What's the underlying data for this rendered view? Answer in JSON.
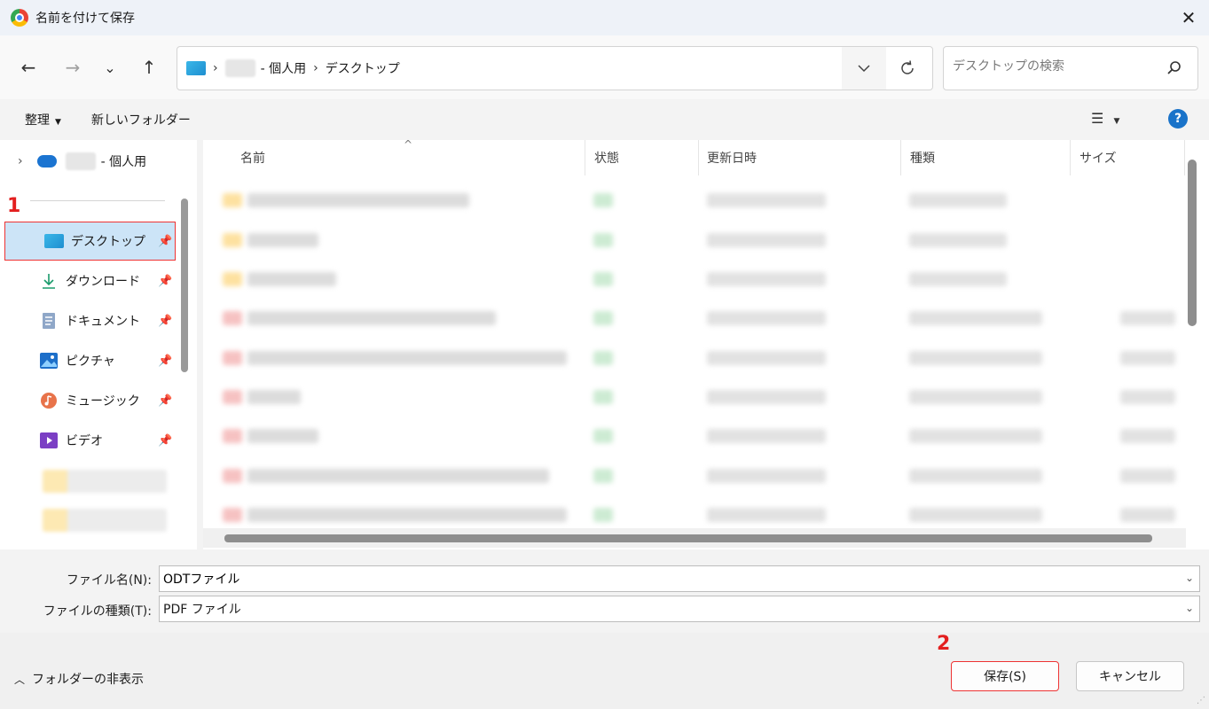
{
  "window": {
    "title": "名前を付けて保存",
    "close_label": "✕"
  },
  "nav": {
    "back": "←",
    "forward": "→",
    "recent": "⌄",
    "up": "↑",
    "breadcrumb": {
      "account_suffix": "- 個人用",
      "current": "デスクトップ",
      "separator": "›"
    },
    "search_placeholder": "デスクトップの検索"
  },
  "commands": {
    "organize": "整理",
    "new_folder": "新しいフォルダー"
  },
  "sidebar": {
    "onedrive_suffix": "- 個人用",
    "items": [
      {
        "label": "デスクトップ",
        "icon": "desktop-icon",
        "pinned": true,
        "selected": true
      },
      {
        "label": "ダウンロード",
        "icon": "download-icon",
        "pinned": true
      },
      {
        "label": "ドキュメント",
        "icon": "document-icon",
        "pinned": true
      },
      {
        "label": "ピクチャ",
        "icon": "pictures-icon",
        "pinned": true
      },
      {
        "label": "ミュージック",
        "icon": "music-icon",
        "pinned": true
      },
      {
        "label": "ビデオ",
        "icon": "video-icon",
        "pinned": true
      }
    ]
  },
  "columns": [
    "名前",
    "状態",
    "更新日時",
    "種類",
    "サイズ"
  ],
  "filename": {
    "label": "ファイル名(N):",
    "value": "ODTファイル"
  },
  "filetype": {
    "label": "ファイルの種類(T):",
    "value": "PDF ファイル"
  },
  "footer": {
    "hide_folders": "フォルダーの非表示",
    "save": "保存(S)",
    "cancel": "キャンセル"
  },
  "annotations": {
    "step1": "1",
    "step2": "2"
  },
  "colors": {
    "selection": "#cce4f7",
    "highlight_border": "#e33333",
    "accent": "#1a73c9"
  }
}
